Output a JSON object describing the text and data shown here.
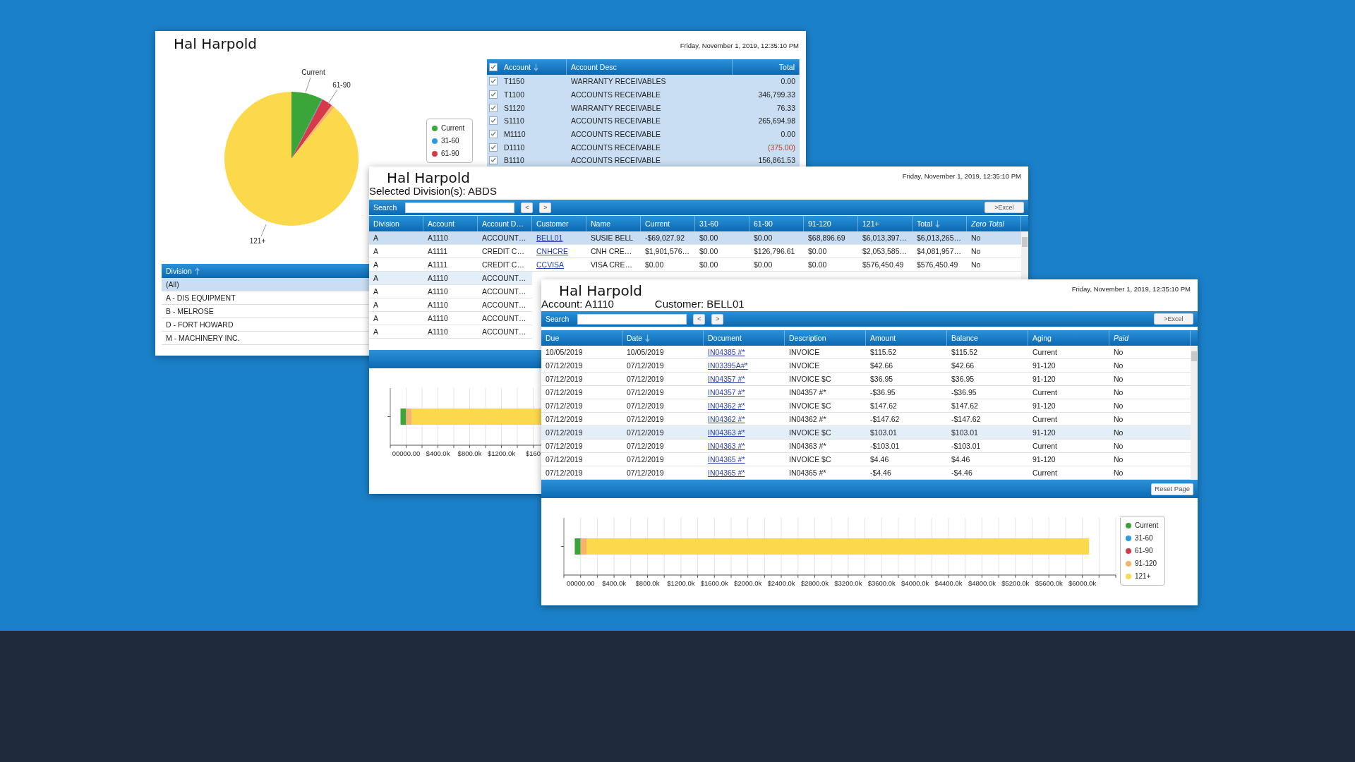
{
  "overview_window": {
    "title": "Hal Harpold",
    "timestamp": "Friday, November 1, 2019, 12:35:10 PM",
    "pie_labels": [
      "Current",
      "61-90",
      "121+"
    ],
    "legend": [
      {
        "label": "Current",
        "color": "#3aa63a"
      },
      {
        "label": "31-60",
        "color": "#2c9be0"
      },
      {
        "label": "61-90",
        "color": "#d63a4a"
      }
    ],
    "accounts": {
      "all_checked": true,
      "columns": [
        {
          "label": "Account",
          "sorted": true,
          "ascending": false,
          "kind": "text"
        },
        {
          "label": "Account Desc",
          "sorted": false,
          "kind": "text"
        },
        {
          "label": "Total",
          "sorted": false,
          "kind": "amount"
        }
      ],
      "rows": [
        {
          "checked": true,
          "account": "T1150",
          "desc": "WARRANTY RECEIVABLES",
          "total": "0.00",
          "negative": false
        },
        {
          "checked": true,
          "account": "T1100",
          "desc": "ACCOUNTS RECEIVABLE",
          "total": "346,799.33",
          "negative": false
        },
        {
          "checked": true,
          "account": "S1120",
          "desc": "WARRANTY RECEIVABLE",
          "total": "76.33",
          "negative": false
        },
        {
          "checked": true,
          "account": "S1110",
          "desc": "ACCOUNTS RECEIVABLE",
          "total": "265,694.98",
          "negative": false
        },
        {
          "checked": true,
          "account": "M1110",
          "desc": "ACCOUNTS RECEIVABLE",
          "total": "0.00",
          "negative": false
        },
        {
          "checked": true,
          "account": "D1110",
          "desc": "ACCOUNTS RECEIVABLE",
          "total": "(375.00)",
          "negative": true
        },
        {
          "checked": true,
          "account": "B1110",
          "desc": "ACCOUNTS RECEIVABLE",
          "total": "156,861.53",
          "negative": false
        }
      ]
    },
    "divisions": {
      "header": "Division",
      "sorted": true,
      "ascending": true,
      "items": [
        {
          "label": "(All)",
          "selected": true
        },
        {
          "label": "A - DIS EQUIPMENT",
          "selected": false
        },
        {
          "label": "B - MELROSE",
          "selected": false
        },
        {
          "label": "D - FORT HOWARD",
          "selected": false
        },
        {
          "label": "M - MACHINERY INC.",
          "selected": false
        }
      ]
    }
  },
  "division_window": {
    "title": "Hal Harpold",
    "subtitle": "Selected Division(s): ABDS",
    "timestamp": "Friday, November 1, 2019, 12:35:10 PM",
    "search": {
      "label": "Search"
    },
    "prev": "<",
    "next": ">",
    "excel": ">Excel",
    "columns": [
      {
        "label": "Division",
        "sorted": false,
        "italic": false,
        "kind": "text"
      },
      {
        "label": "Account",
        "sorted": false,
        "italic": false,
        "kind": "text"
      },
      {
        "label": "Account D…",
        "sorted": false,
        "italic": false,
        "kind": "text"
      },
      {
        "label": "Customer",
        "sorted": false,
        "italic": false,
        "kind": "link"
      },
      {
        "label": "Name",
        "sorted": false,
        "italic": false,
        "kind": "text"
      },
      {
        "label": "Current",
        "sorted": false,
        "italic": false,
        "kind": "text"
      },
      {
        "label": "31-60",
        "sorted": false,
        "italic": false,
        "kind": "text"
      },
      {
        "label": "61-90",
        "sorted": false,
        "italic": false,
        "kind": "text"
      },
      {
        "label": "91-120",
        "sorted": false,
        "italic": false,
        "kind": "text"
      },
      {
        "label": "121+",
        "sorted": false,
        "italic": false,
        "kind": "text"
      },
      {
        "label": "Total",
        "sorted": true,
        "ascending": false,
        "italic": false,
        "kind": "text"
      },
      {
        "label": "Zero Total",
        "sorted": false,
        "italic": true,
        "kind": "text"
      }
    ],
    "rows": [
      {
        "selected": true,
        "highlighted": false,
        "cells": [
          "A",
          "A1110",
          "ACCOUNT…",
          "BELL01",
          "SUSIE BELL",
          "-$69,027.92",
          "$0.00",
          "$0.00",
          "$68,896.69",
          "$6,013,397…",
          "$6,013,265…",
          "No"
        ]
      },
      {
        "selected": false,
        "highlighted": false,
        "cells": [
          "A",
          "A1111",
          "CREDIT C…",
          "CNHCRE",
          "CNH CRE…",
          "$1,901,576…",
          "$0.00",
          "$126,796.61",
          "$0.00",
          "$2,053,585…",
          "$4,081,957…",
          "No"
        ]
      },
      {
        "selected": false,
        "highlighted": false,
        "cells": [
          "A",
          "A1111",
          "CREDIT C…",
          "CCVISA",
          "VISA CRE…",
          "$0.00",
          "$0.00",
          "$0.00",
          "$0.00",
          "$576,450.49",
          "$576,450.49",
          "No"
        ]
      },
      {
        "selected": false,
        "highlighted": true,
        "cells": [
          "A",
          "A1110",
          "ACCOUNT…"
        ]
      },
      {
        "selected": false,
        "highlighted": false,
        "cells": [
          "A",
          "A1110",
          "ACCOUNT…"
        ]
      },
      {
        "selected": false,
        "highlighted": false,
        "cells": [
          "A",
          "A1110",
          "ACCOUNT…"
        ]
      },
      {
        "selected": false,
        "highlighted": false,
        "cells": [
          "A",
          "A1110",
          "ACCOUNT…"
        ]
      },
      {
        "selected": false,
        "highlighted": false,
        "cells": [
          "A",
          "A1110",
          "ACCOUNT…"
        ]
      }
    ],
    "axis_labels": [
      "00000.00",
      "$400.0k",
      "$800.0k",
      "$1200.0k",
      "$160"
    ]
  },
  "customer_window": {
    "title": "Hal Harpold",
    "account": "Account: A1110",
    "customer": "Customer: BELL01",
    "timestamp": "Friday, November 1, 2019, 12:35:10 PM",
    "search": {
      "label": "Search"
    },
    "prev": "<",
    "next": ">",
    "excel": ">Excel",
    "reset": "Reset Page",
    "columns": [
      {
        "label": "Due",
        "sorted": false,
        "italic": false,
        "kind": "text"
      },
      {
        "label": "Date",
        "sorted": true,
        "ascending": false,
        "italic": false,
        "kind": "text"
      },
      {
        "label": "Document",
        "sorted": false,
        "italic": false,
        "kind": "link"
      },
      {
        "label": "Description",
        "sorted": false,
        "italic": false,
        "kind": "text"
      },
      {
        "label": "Amount",
        "sorted": false,
        "italic": false,
        "kind": "text"
      },
      {
        "label": "Balance",
        "sorted": false,
        "italic": false,
        "kind": "text"
      },
      {
        "label": "Aging",
        "sorted": false,
        "italic": false,
        "kind": "text"
      },
      {
        "label": "Paid",
        "sorted": false,
        "italic": true,
        "kind": "text"
      }
    ],
    "rows": [
      {
        "selected": false,
        "highlighted": false,
        "cells": [
          "10/05/2019",
          "10/05/2019",
          "IN04385 #*",
          "INVOICE",
          "$115.52",
          "$115.52",
          "Current",
          "No"
        ]
      },
      {
        "selected": false,
        "highlighted": false,
        "cells": [
          "07/12/2019",
          "07/12/2019",
          "IN03395A#*",
          "INVOICE",
          "$42.66",
          "$42.66",
          "91-120",
          "No"
        ]
      },
      {
        "selected": false,
        "highlighted": false,
        "cells": [
          "07/12/2019",
          "07/12/2019",
          "IN04357 #*",
          "INVOICE $C",
          "$36.95",
          "$36.95",
          "91-120",
          "No"
        ]
      },
      {
        "selected": false,
        "highlighted": false,
        "cells": [
          "07/12/2019",
          "07/12/2019",
          "IN04357 #*",
          "IN04357 #*",
          "-$36.95",
          "-$36.95",
          "Current",
          "No"
        ]
      },
      {
        "selected": false,
        "highlighted": false,
        "cells": [
          "07/12/2019",
          "07/12/2019",
          "IN04362 #*",
          "INVOICE $C",
          "$147.62",
          "$147.62",
          "91-120",
          "No"
        ]
      },
      {
        "selected": false,
        "highlighted": false,
        "cells": [
          "07/12/2019",
          "07/12/2019",
          "IN04362 #*",
          "IN04362 #*",
          "-$147.62",
          "-$147.62",
          "Current",
          "No"
        ]
      },
      {
        "selected": false,
        "highlighted": true,
        "cells": [
          "07/12/2019",
          "07/12/2019",
          "IN04363 #*",
          "INVOICE $C",
          "$103.01",
          "$103.01",
          "91-120",
          "No"
        ]
      },
      {
        "selected": false,
        "highlighted": false,
        "cells": [
          "07/12/2019",
          "07/12/2019",
          "IN04363 #*",
          "IN04363 #*",
          "-$103.01",
          "-$103.01",
          "Current",
          "No"
        ]
      },
      {
        "selected": false,
        "highlighted": false,
        "cells": [
          "07/12/2019",
          "07/12/2019",
          "IN04365 #*",
          "INVOICE $C",
          "$4.46",
          "$4.46",
          "91-120",
          "No"
        ]
      },
      {
        "selected": false,
        "highlighted": false,
        "cells": [
          "07/12/2019",
          "07/12/2019",
          "IN04365 #*",
          "IN04365 #*",
          "-$4.46",
          "-$4.46",
          "Current",
          "No"
        ]
      }
    ],
    "chart_data": {
      "type": "bar",
      "orientation": "horizontal",
      "stacked": true,
      "grid": true,
      "xlim": [
        -200000,
        6400000
      ],
      "xticks": [
        {
          "value": 0,
          "label": "00000.00"
        },
        {
          "value": 400000,
          "label": "$400.0k"
        },
        {
          "value": 800000,
          "label": "$800.0k"
        },
        {
          "value": 1200000,
          "label": "$1200.0k"
        },
        {
          "value": 1600000,
          "label": "$1600.0k"
        },
        {
          "value": 2000000,
          "label": "$2000.0k"
        },
        {
          "value": 2400000,
          "label": "$2400.0k"
        },
        {
          "value": 2800000,
          "label": "$2800.0k"
        },
        {
          "value": 3200000,
          "label": "$3200.0k"
        },
        {
          "value": 3600000,
          "label": "$3600.0k"
        },
        {
          "value": 4000000,
          "label": "$4000.0k"
        },
        {
          "value": 4400000,
          "label": "$4400.0k"
        },
        {
          "value": 4800000,
          "label": "$4800.0k"
        },
        {
          "value": 5200000,
          "label": "$5200.0k"
        },
        {
          "value": 5600000,
          "label": "$5600.0k"
        },
        {
          "value": 6000000,
          "label": "$6000.0k"
        }
      ],
      "series": [
        {
          "name": "Current",
          "color": "#3aa63a",
          "values": [
            -70000
          ]
        },
        {
          "name": "31-60",
          "color": "#2c9be0",
          "values": [
            0
          ]
        },
        {
          "name": "61-90",
          "color": "#d63a4a",
          "values": [
            0
          ]
        },
        {
          "name": "91-120",
          "color": "#f7b26b",
          "values": [
            70000
          ]
        },
        {
          "name": "121+",
          "color": "#fcd94b",
          "values": [
            6010000
          ]
        }
      ]
    }
  }
}
